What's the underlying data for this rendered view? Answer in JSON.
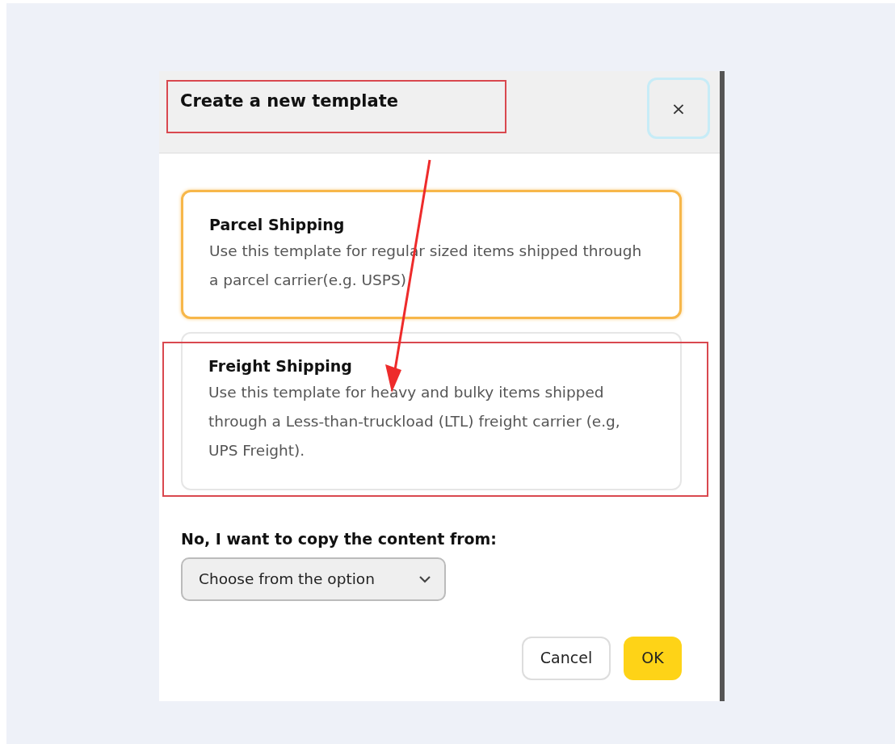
{
  "dialog": {
    "title": "Create a new template",
    "title_highlighted": true,
    "close_label": "×",
    "options": [
      {
        "title": "Parcel Shipping",
        "description": "Use this template for regular sized items shipped through a parcel carrier(e.g. USPS)",
        "selected": true,
        "highlighted": false
      },
      {
        "title": "Freight Shipping",
        "description": "Use this template for heavy and bulky items shipped through a Less-than-truckload (LTL) freight carrier (e.g, UPS Freight).",
        "selected": false,
        "highlighted": true
      }
    ],
    "copy_label": "No, I want to copy the content from:",
    "copy_select": {
      "placeholder": "Choose from the option"
    },
    "buttons": [
      {
        "label": "Cancel",
        "kind": "secondary"
      },
      {
        "label": "OK",
        "kind": "primary"
      }
    ]
  }
}
